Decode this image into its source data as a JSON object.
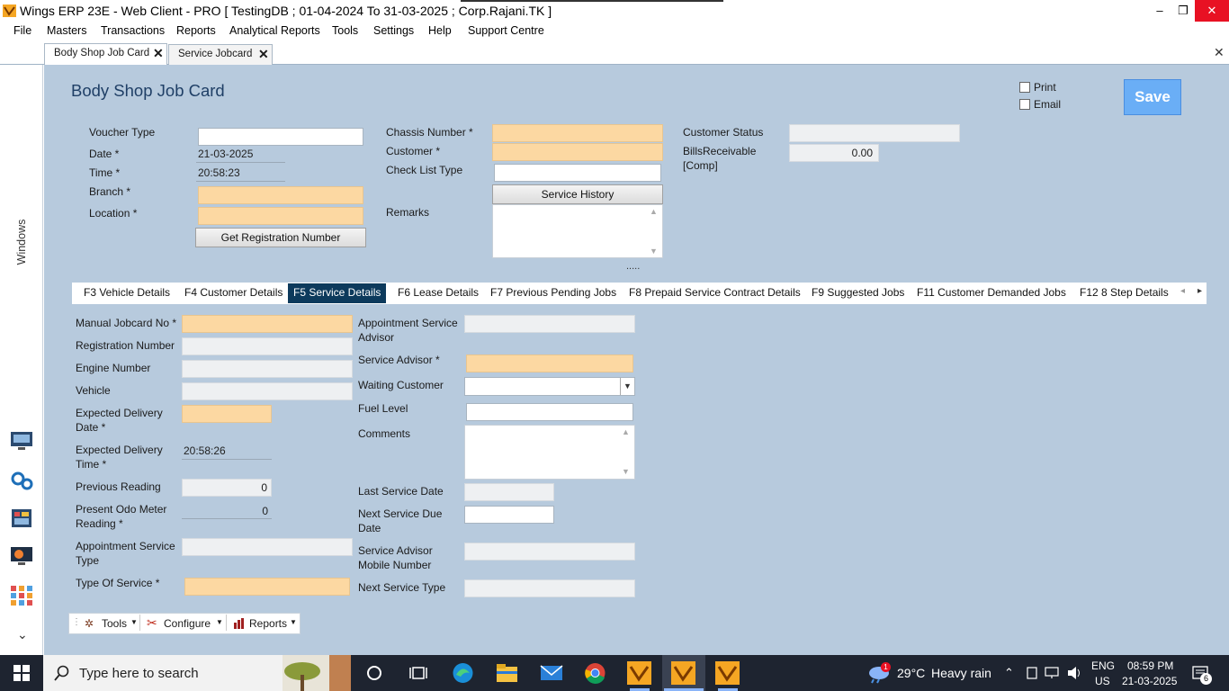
{
  "window": {
    "title": "Wings ERP 23E - Web Client - PRO [ TestingDB ; 01-04-2024 To 31-03-2025 ; Corp.Rajani.TK ]",
    "minimize": "‒",
    "restore": "❐",
    "close": "✕"
  },
  "menu": [
    "File",
    "Masters",
    "Transactions",
    "Reports",
    "Analytical Reports",
    "Tools",
    "Settings",
    "Help",
    "Support Centre"
  ],
  "tabs": [
    {
      "label": "Body Shop Job Card",
      "close": "✕"
    },
    {
      "label": "Service Jobcard",
      "close": "✕"
    }
  ],
  "close_all": "✕",
  "rail": {
    "label": "Windows",
    "chevron": "⌄"
  },
  "form": {
    "title": "Body Shop Job Card",
    "print_label": "Print",
    "email_label": "Email",
    "save_label": "Save",
    "voucher_type_label": "Voucher Type",
    "date_label": "Date *",
    "date_value": "21-03-2025",
    "time_label": "Time *",
    "time_value": "20:58:23",
    "branch_label": "Branch *",
    "location_label": "Location *",
    "get_reg_button": "Get Registration Number",
    "chassis_label": "Chassis Number *",
    "customer_label": "Customer *",
    "checklist_label": "Check List Type",
    "service_history_button": "Service History",
    "remarks_label": "Remarks",
    "customer_status_label": "Customer Status",
    "bills_receivable_label_1": "BillsReceivable",
    "bills_receivable_label_2": "[Comp]",
    "bills_receivable_value": "0.00",
    "splitter": "....."
  },
  "section_tabs": [
    "F3 Vehicle Details",
    "F4 Customer Details",
    "F5 Service Details",
    "F6 Lease Details",
    "F7 Previous Pending Jobs",
    "F8 Prepaid Service Contract Details",
    "F9 Suggested Jobs",
    "F11 Customer Demanded Jobs",
    "F12 8 Step Details"
  ],
  "section_tabs_active": "F5 Service Details",
  "service": {
    "manual_jobcard_label": "Manual Jobcard No *",
    "registration_label": "Registration Number",
    "engine_label": "Engine Number",
    "vehicle_label": "Vehicle",
    "exp_delivery_date_label_1": "Expected Delivery",
    "exp_delivery_date_label_2": "Date *",
    "exp_delivery_time_label_1": "Expected Delivery",
    "exp_delivery_time_label_2": "Time *",
    "exp_delivery_time_value": "20:58:26",
    "prev_reading_label": "Previous Reading",
    "prev_reading_value": "0",
    "odo_label_1": "Present Odo Meter",
    "odo_label_2": "Reading *",
    "odo_value": "0",
    "appt_service_type_label_1": "Appointment Service",
    "appt_service_type_label_2": "Type",
    "type_of_service_label": "Type Of Service *",
    "appt_advisor_label_1": "Appointment Service",
    "appt_advisor_label_2": "Advisor",
    "service_advisor_label": "Service Advisor *",
    "waiting_customer_label": "Waiting Customer",
    "fuel_level_label": "Fuel Level",
    "comments_label": "Comments",
    "last_service_date_label": "Last Service Date",
    "next_service_due_label_1": "Next Service Due",
    "next_service_due_label_2": "Date",
    "advisor_mobile_label_1": "Service Advisor",
    "advisor_mobile_label_2": "Mobile Number",
    "next_service_type_label": "Next Service Type"
  },
  "toolbar": {
    "tools": "Tools",
    "configure": "Configure",
    "reports": "Reports"
  },
  "taskbar": {
    "search_placeholder": "Type here to search",
    "weather_temp": "29°C",
    "weather_text": "Heavy rain",
    "weather_badge": "1",
    "lang_1": "ENG",
    "lang_2": "US",
    "time": "08:59 PM",
    "date": "21-03-2025",
    "notifications": "6"
  }
}
